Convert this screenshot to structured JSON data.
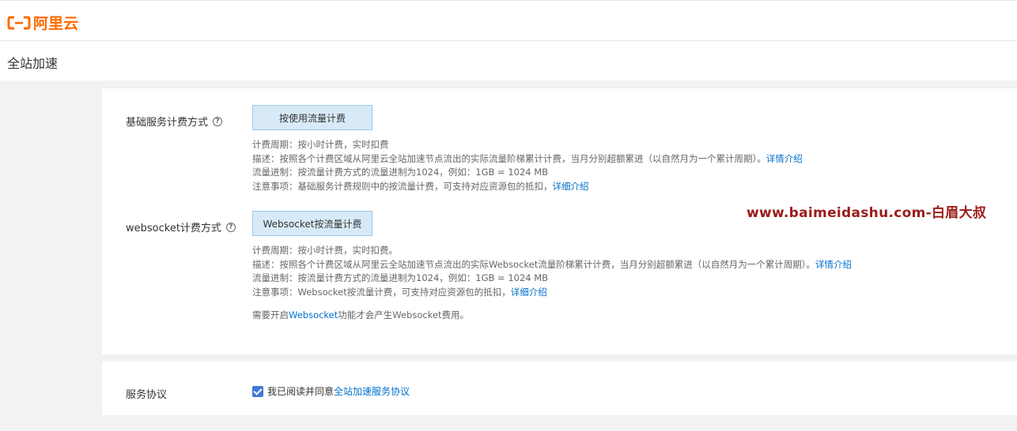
{
  "brand": {
    "name": "阿里云",
    "color": "#ff6a00",
    "icon": "aliyun-logo-icon"
  },
  "page": {
    "title": "全站加速"
  },
  "base_service": {
    "label": "基础服务计费方式",
    "help_icon": "?",
    "option": "按使用流量计费",
    "lines": [
      "计费周期：按小时计费，实时扣费",
      "描述：按照各个计费区域从阿里云全站加速节点流出的实际流量阶梯累计计费，当月分别超额累进（以自然月为一个累计周期）。",
      "流量进制：按流量计费方式的流量进制为1024，例如：1GB = 1024 MB",
      "注意事项：基础服务计费规则中的按流量计费，可支持对应资源包的抵扣，"
    ],
    "links": [
      "详情介绍",
      "详细介绍"
    ]
  },
  "websocket": {
    "label": "websocket计费方式",
    "help_icon": "?",
    "option": "Websocket按流量计费",
    "lines": [
      "计费周期：按小时计费，实时扣费。",
      "描述：按照各个计费区域从阿里云全站加速节点流出的实际Websocket流量阶梯累计计费，当月分别超额累进（以自然月为一个累计周期）。",
      "流量进制：按流量计费方式的流量进制为1024，例如：1GB = 1024 MB",
      "注意事项：Websocket按流量计费，可支持对应资源包的抵扣，"
    ],
    "links": [
      "详情介绍",
      "详细介绍"
    ],
    "note_prefix": "需要开启",
    "note_link": "Websocket",
    "note_suffix": "功能才会产生Websocket费用。"
  },
  "watermark": "www.baimeidashu.com-白眉大叔",
  "agreement": {
    "label": "服务协议",
    "checked": true,
    "text": "我已阅读并同意",
    "link": "全站加速服务协议"
  }
}
